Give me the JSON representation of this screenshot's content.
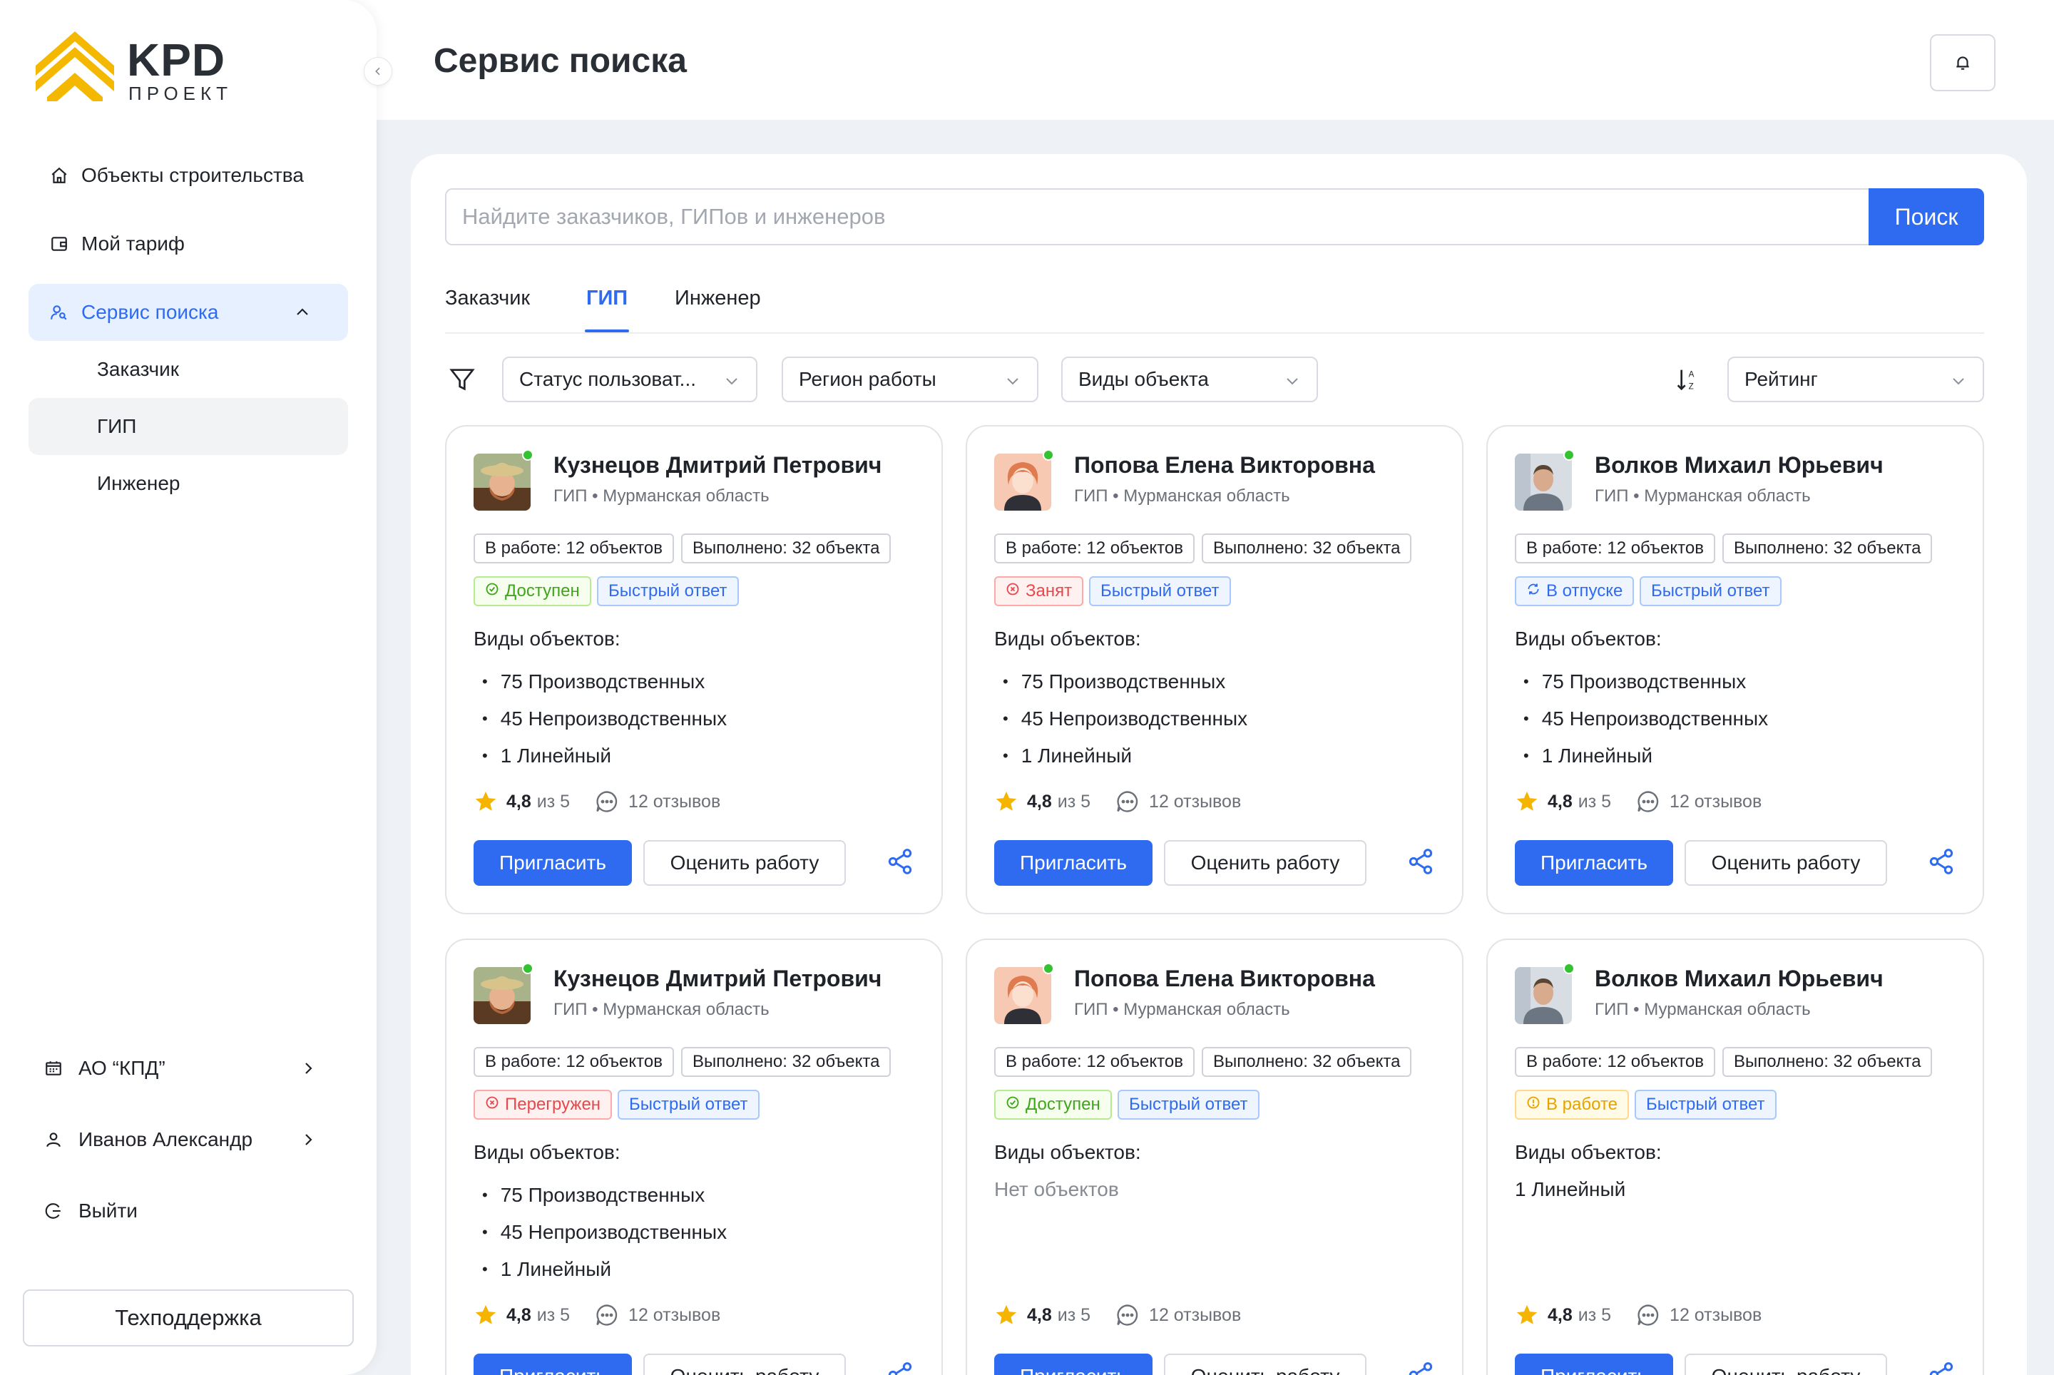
{
  "logo": {
    "main": "KPD",
    "sub": "ПРОЕКТ"
  },
  "sidebar": {
    "nav": [
      {
        "label": "Объекты строительства",
        "icon": "home-icon"
      },
      {
        "label": "Мой тариф",
        "icon": "wallet-icon"
      },
      {
        "label": "Сервис поиска",
        "icon": "users-search-icon",
        "expanded": true
      }
    ],
    "sub": [
      {
        "label": "Заказчик"
      },
      {
        "label": "ГИП",
        "selected": true
      },
      {
        "label": "Инженер"
      }
    ],
    "bottom": [
      {
        "label": "АО “КПД”",
        "icon": "company-icon"
      },
      {
        "label": "Иванов Александр",
        "icon": "user-icon"
      },
      {
        "label": "Выйти",
        "icon": "logout-icon"
      }
    ],
    "support": "Техподдержка"
  },
  "header": {
    "title": "Сервис поиска"
  },
  "search": {
    "placeholder": "Найдите заказчиков, ГИПов и инженеров",
    "button": "Поиск"
  },
  "tabs": [
    {
      "label": "Заказчик"
    },
    {
      "label": "ГИП",
      "active": true
    },
    {
      "label": "Инженер"
    }
  ],
  "filters": {
    "status": "Статус пользоват...",
    "region": "Регион работы",
    "types": "Виды объекта",
    "sort": "Рейтинг"
  },
  "colors": {
    "primary": "#2f6bf0",
    "green": "#52c41a",
    "red": "#f5222d",
    "orange": "#faad14",
    "blue": "#1677ff"
  },
  "cards": [
    {
      "name": "Кузнецов Дмитрий Петрович",
      "role": "ГИП",
      "region": "Мурманская область",
      "in_work": "В работе: 12 объектов",
      "done": "Выполнено: 32 объекта",
      "status": "Доступен",
      "status_kind": "green",
      "fast": "Быстрый ответ",
      "types_label": "Виды объектов:",
      "types": [
        "75 Производственных",
        "45 Непроизводственных",
        "1 Линейный"
      ],
      "rating": "4,8",
      "rating_of": "из 5",
      "reviews": "12 отзывов",
      "invite": "Пригласить",
      "rate": "Оценить работу",
      "avatar": "avatar-man-hat"
    },
    {
      "name": "Попова Елена Викторовна",
      "role": "ГИП",
      "region": "Мурманская область",
      "in_work": "В работе: 12 объектов",
      "done": "Выполнено: 32 объекта",
      "status": "Занят",
      "status_kind": "red",
      "fast": "Быстрый ответ",
      "types_label": "Виды объектов:",
      "types": [
        "75 Производственных",
        "45 Непроизводственных",
        "1 Линейный"
      ],
      "rating": "4,8",
      "rating_of": "из 5",
      "reviews": "12 отзывов",
      "invite": "Пригласить",
      "rate": "Оценить работу",
      "avatar": "avatar-woman-illustration"
    },
    {
      "name": "Волков Михаил Юрьевич",
      "role": "ГИП",
      "region": "Мурманская область",
      "in_work": "В работе: 12 объектов",
      "done": "Выполнено: 32 объекта",
      "status": "В отпуске",
      "status_kind": "blue",
      "fast": "Быстрый ответ",
      "types_label": "Виды объектов:",
      "types": [
        "75 Производственных",
        "45 Непроизводственных",
        "1 Линейный"
      ],
      "rating": "4,8",
      "rating_of": "из 5",
      "reviews": "12 отзывов",
      "invite": "Пригласить",
      "rate": "Оценить работу",
      "avatar": "avatar-man-photo"
    },
    {
      "name": "Кузнецов Дмитрий Петрович",
      "role": "ГИП",
      "region": "Мурманская область",
      "in_work": "В работе: 12 объектов",
      "done": "Выполнено: 32 объекта",
      "status": "Перегружен",
      "status_kind": "red",
      "fast": "Быстрый ответ",
      "types_label": "Виды объектов:",
      "types": [
        "75 Производственных",
        "45 Непроизводственных",
        "1 Линейный"
      ],
      "rating": "4,8",
      "rating_of": "из 5",
      "reviews": "12 отзывов",
      "invite": "Пригласить",
      "rate": "Оценить работу",
      "avatar": "avatar-man-hat"
    },
    {
      "name": "Попова Елена Викторовна",
      "role": "ГИП",
      "region": "Мурманская область",
      "in_work": "В работе: 12 объектов",
      "done": "Выполнено: 32 объекта",
      "status": "Доступен",
      "status_kind": "green",
      "fast": "Быстрый ответ",
      "types_label": "Виды объектов:",
      "empty_text": "Нет объектов",
      "rating": "4,8",
      "rating_of": "из 5",
      "reviews": "12 отзывов",
      "invite": "Пригласить",
      "rate": "Оценить работу",
      "avatar": "avatar-woman-illustration"
    },
    {
      "name": "Волков Михаил Юрьевич",
      "role": "ГИП",
      "region": "Мурманская область",
      "in_work": "В работе: 12 объектов",
      "done": "Выполнено: 32 объекта",
      "status": "В работе",
      "status_kind": "orange",
      "fast": "Быстрый ответ",
      "types_label": "Виды объектов:",
      "plain_text": "1 Линейный",
      "rating": "4,8",
      "rating_of": "из 5",
      "reviews": "12 отзывов",
      "invite": "Пригласить",
      "rate": "Оценить работу",
      "avatar": "avatar-man-photo"
    }
  ]
}
